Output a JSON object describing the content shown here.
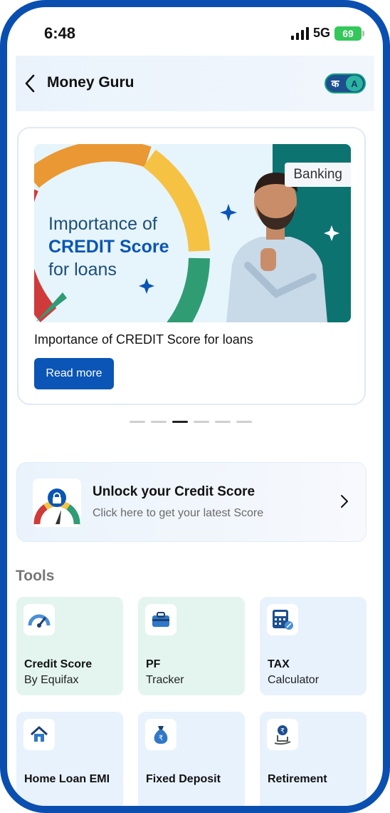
{
  "status": {
    "time": "6:48",
    "network": "5G",
    "battery": "69"
  },
  "header": {
    "title": "Money Guru",
    "lang_hindi": "क",
    "lang_english": "A"
  },
  "article": {
    "banner_line1": "Importance of",
    "banner_line2": "CREDIT Score",
    "banner_line3": "for loans",
    "tag": "Banking",
    "title": "Importance of CREDIT Score for loans",
    "read_more": "Read more",
    "carousel": {
      "count": 6,
      "active_index": 2
    }
  },
  "credit_banner": {
    "title": "Unlock your Credit Score",
    "subtitle": "Click here to get your latest Score"
  },
  "tools": {
    "heading": "Tools",
    "items": [
      {
        "name": "Credit Score",
        "sub": "By Equifax",
        "icon": "speedometer-icon",
        "bg": "#e3f5ee"
      },
      {
        "name": "PF",
        "sub": "Tracker",
        "icon": "briefcase-icon",
        "bg": "#e3f5ee"
      },
      {
        "name": "TAX",
        "sub": "Calculator",
        "icon": "calculator-icon",
        "bg": "#e8f2fd"
      },
      {
        "name": "Home Loan EMI",
        "sub": "",
        "icon": "home-icon",
        "bg": "#e8f2fd"
      },
      {
        "name": "Fixed Deposit",
        "sub": "",
        "icon": "money-bag-icon",
        "bg": "#e8f2fd"
      },
      {
        "name": "Retirement",
        "sub": "",
        "icon": "rocking-chair-icon",
        "bg": "#e8f2fd"
      }
    ]
  },
  "colors": {
    "frame": "#0a4fb0",
    "primary": "#0a55b5",
    "banner_teal": "#0d7371"
  }
}
